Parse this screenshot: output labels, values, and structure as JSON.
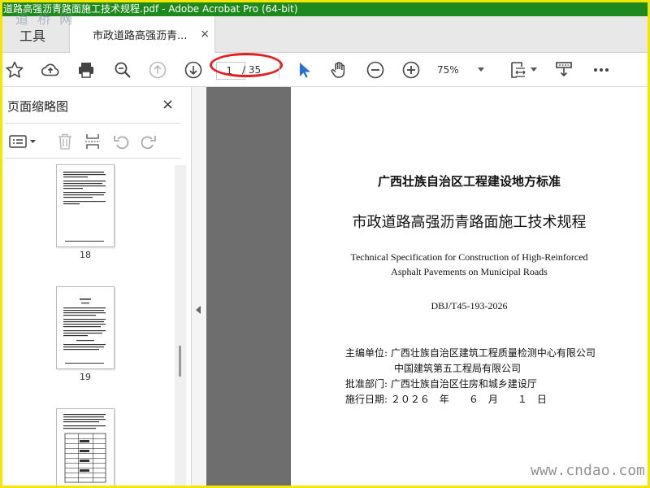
{
  "window": {
    "title": "道路高强沥青路面施工技术规程.pdf - Adobe Acrobat Pro (64-bit)",
    "watermark_top": "道 桥 网"
  },
  "tabs": {
    "tools_label": "工具",
    "document_label": "市政道路高强沥青...",
    "close_symbol": "×"
  },
  "toolbar": {
    "icons": [
      "bookmark-star-icon",
      "cloud-upload-icon",
      "print-icon",
      "zoom-out-magnifier-icon",
      "prev-page-icon",
      "next-page-icon",
      "select-cursor-icon",
      "hand-tool-icon",
      "zoom-out-icon",
      "zoom-in-icon",
      "page-fit-icon",
      "comment-stamp-icon",
      "more-icon"
    ],
    "current_page": "1",
    "total_pages": "/ 35",
    "zoom": "75%"
  },
  "sidebar": {
    "title": "页面缩略图",
    "close_symbol": "×",
    "thumbnails": [
      {
        "label": "18"
      },
      {
        "label": "19"
      },
      {
        "label": ""
      }
    ]
  },
  "document": {
    "standard_title": "广西壮族自治区工程建设地方标准",
    "main_title": "市政道路高强沥青路面施工技术规程",
    "english_title_line1": "Technical Specification for Construction of High-Reinforced",
    "english_title_line2": "Asphalt Pavements on Municipal Roads",
    "code": "DBJ/T45-193-2026",
    "editor_label": "主编单位:",
    "editor_1": "广西壮族自治区建筑工程质量检测中心有限公司",
    "editor_2": "中国建筑第五工程局有限公司",
    "approver_label": "批准部门:",
    "approver": "广西壮族自治区住房和城乡建设厅",
    "date_label": "施行日期:",
    "date_value": "２０２６　年　　６　月　　１　日"
  },
  "watermark": "www.cndao.com",
  "colors": {
    "title_bar": "#1e8a1e",
    "frame": "#f5e600",
    "annotation_ellipse": "#e02020",
    "select_cursor": "#2a6fd6"
  }
}
